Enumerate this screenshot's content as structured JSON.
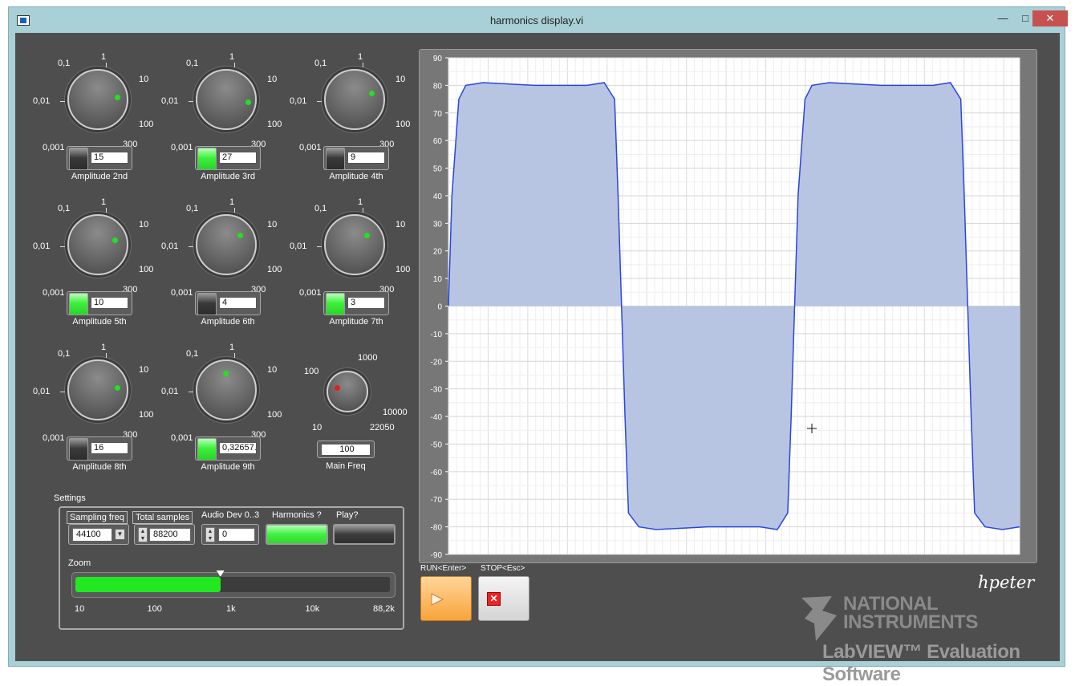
{
  "window": {
    "title": "harmonics display.vi",
    "minimize": "—",
    "maximize": "□",
    "close": "✕"
  },
  "knob_scale": [
    "0,1",
    "1",
    "10",
    "0,01",
    "100",
    "0,001",
    "300"
  ],
  "knobs": [
    {
      "label": "Amplitude 2nd",
      "value": "15",
      "toggle_on": false
    },
    {
      "label": "Amplitude 3rd",
      "value": "27",
      "toggle_on": true
    },
    {
      "label": "Amplitude 4th",
      "value": "9",
      "toggle_on": false
    },
    {
      "label": "Amplitude 5th",
      "value": "10",
      "toggle_on": true
    },
    {
      "label": "Amplitude 6th",
      "value": "4",
      "toggle_on": false
    },
    {
      "label": "Amplitude 7th",
      "value": "3",
      "toggle_on": true
    },
    {
      "label": "Amplitude 8th",
      "value": "16",
      "toggle_on": false
    },
    {
      "label": "Amplitude 9th",
      "value": "0,32657…",
      "toggle_on": true
    }
  ],
  "main_freq": {
    "label": "Main Freq",
    "value": "100",
    "scale": [
      "1000",
      "100",
      "10000",
      "10",
      "22050"
    ]
  },
  "settings": {
    "title": "Settings",
    "sampling_freq_label": "Sampling freq",
    "sampling_freq_value": "44100",
    "total_samples_label": "Total samples",
    "total_samples_value": "88200",
    "audio_dev_label": "Audio Dev 0..3",
    "audio_dev_value": "0",
    "harmonics_label": "Harmonics ?",
    "harmonics_on": true,
    "play_label": "Play?",
    "play_on": false,
    "zoom_label": "Zoom",
    "zoom_ticks": [
      "10",
      "100",
      "1k",
      "10k",
      "88,2k"
    ],
    "zoom_fraction": 0.46
  },
  "run": {
    "label": "RUN<Enter>"
  },
  "stop": {
    "label": "STOP<Esc>"
  },
  "signature": "hpeter",
  "watermark": {
    "line1": "NATIONAL",
    "line2": "INSTRUMENTS",
    "line3": "LabVIEW™ Evaluation Software"
  },
  "colors": {
    "panel": "#4e4e4e",
    "led_green": "#22e022",
    "led_red": "#e02020",
    "trace": "#2a45e0",
    "fill": "#b7c5e3",
    "run": "#f8a43a"
  },
  "chart_data": {
    "type": "area",
    "ylim": [
      -90,
      90
    ],
    "yticks": [
      "90",
      "80",
      "70",
      "60",
      "50",
      "40",
      "30",
      "20",
      "10",
      "0",
      "-10",
      "-20",
      "-30",
      "-40",
      "-50",
      "-60",
      "-70",
      "-80",
      "-90"
    ],
    "grid": true,
    "series": [
      {
        "x": [
          0,
          2,
          6,
          10,
          20,
          50,
          80,
          90,
          96,
          98,
          100,
          102,
          104,
          110,
          120,
          150,
          180,
          190,
          196,
          198,
          200,
          202,
          206,
          210,
          220,
          250,
          280,
          290,
          296,
          298,
          300,
          302,
          304,
          310,
          320,
          330
        ],
        "y": [
          0,
          40,
          75,
          80,
          81,
          80,
          80,
          81,
          75,
          40,
          0,
          -40,
          -75,
          -80,
          -81,
          -80,
          -80,
          -81,
          -75,
          -40,
          0,
          40,
          75,
          80,
          81,
          80,
          80,
          81,
          75,
          40,
          0,
          -40,
          -75,
          -80,
          -81,
          -80
        ]
      }
    ]
  }
}
